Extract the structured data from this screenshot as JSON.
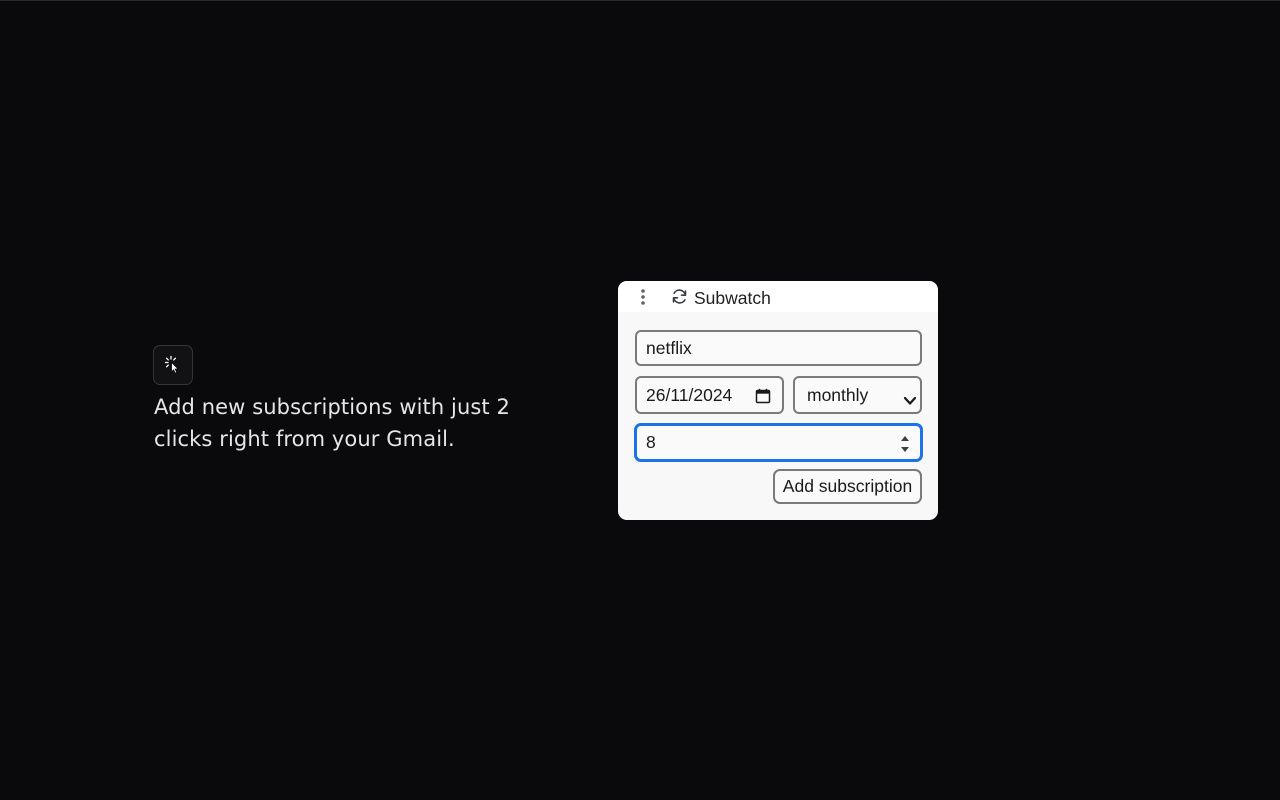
{
  "feature": {
    "icon": "click-sparkle-icon",
    "text": "Add new subscriptions with just 2 clicks right from your Gmail."
  },
  "popup": {
    "menu_icon": "kebab-menu-icon",
    "brand_icon": "refresh-icon",
    "brand_name": "Subwatch",
    "name_value": "netflix",
    "date_value": "26/11/2024",
    "date_icon": "calendar-icon",
    "frequency_value": "monthly",
    "frequency_icon": "chevron-down-icon",
    "amount_value": "8",
    "amount_icon": "spinner-arrows-icon",
    "add_button_label": "Add subscription",
    "accent_color": "#1a73e8"
  }
}
